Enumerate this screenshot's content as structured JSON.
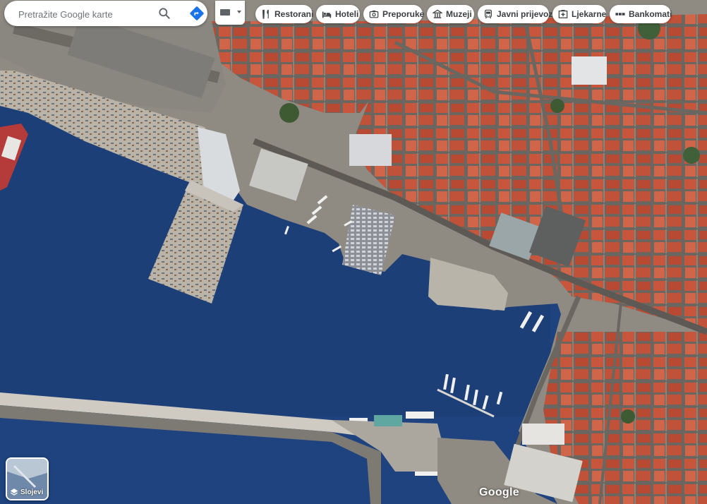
{
  "search": {
    "placeholder": "Pretražite Google karte"
  },
  "chips": [
    {
      "label": "Restorani",
      "icon": "restaurant-icon"
    },
    {
      "label": "Hoteli",
      "icon": "hotel-icon"
    },
    {
      "label": "Preporuke",
      "icon": "camera-icon"
    },
    {
      "label": "Muzeji",
      "icon": "museum-icon"
    },
    {
      "label": "Javni prijevoz",
      "icon": "transit-icon"
    },
    {
      "label": "Ljekarne",
      "icon": "pharmacy-icon"
    },
    {
      "label": "Bankomati",
      "icon": "atm-icon"
    }
  ],
  "layers": {
    "label": "Slojevi"
  },
  "map": {
    "attribution": "Google",
    "view": "satellite"
  },
  "colors": {
    "water": "#1c3f78",
    "roof": "#c8563d",
    "directions": "#1a73e8"
  }
}
